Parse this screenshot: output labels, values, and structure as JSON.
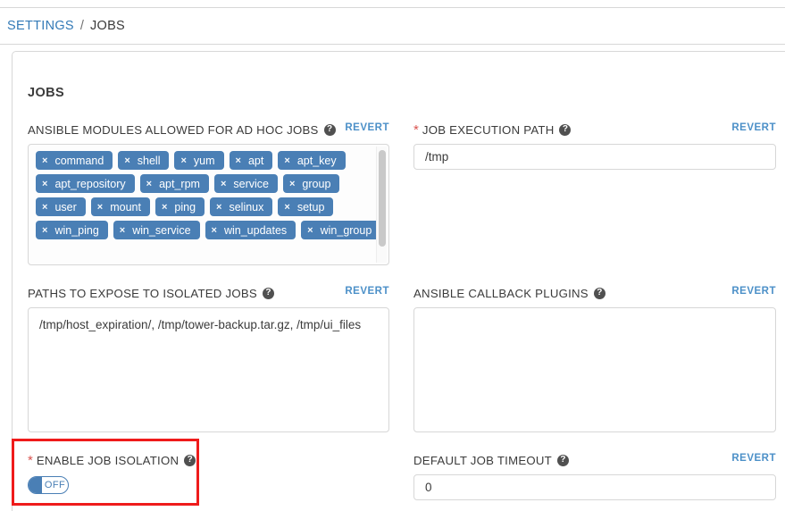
{
  "breadcrumb": {
    "parent": "SETTINGS",
    "separator": "/",
    "current": "JOBS"
  },
  "card": {
    "title": "JOBS"
  },
  "icons": {
    "help": "?",
    "tag_remove": "×"
  },
  "revert_label": "REVERT",
  "fields": {
    "ansible_modules": {
      "label": "ANSIBLE MODULES ALLOWED FOR AD HOC JOBS",
      "required": false,
      "revert": "REVERT",
      "tags": [
        "command",
        "shell",
        "yum",
        "apt",
        "apt_key",
        "apt_repository",
        "apt_rpm",
        "service",
        "group",
        "user",
        "mount",
        "ping",
        "selinux",
        "setup",
        "win_ping",
        "win_service",
        "win_updates",
        "win_group"
      ]
    },
    "job_execution_path": {
      "label": "JOB EXECUTION PATH",
      "required": true,
      "revert": "REVERT",
      "value": "/tmp",
      "placeholder": ""
    },
    "paths_to_expose": {
      "label": "PATHS TO EXPOSE TO ISOLATED JOBS",
      "required": false,
      "revert": "REVERT",
      "value": "/tmp/host_expiration/, /tmp/tower-backup.tar.gz, /tmp/ui_files",
      "placeholder": ""
    },
    "ansible_callback_plugins": {
      "label": "ANSIBLE CALLBACK PLUGINS",
      "required": false,
      "revert": "REVERT",
      "value": "",
      "placeholder": ""
    },
    "enable_job_isolation": {
      "label": "ENABLE JOB ISOLATION",
      "required": true,
      "toggle_state": "OFF"
    },
    "default_job_timeout": {
      "label": "DEFAULT JOB TIMEOUT",
      "required": false,
      "revert": "REVERT",
      "value": "0",
      "placeholder": ""
    }
  },
  "colors": {
    "link": "#337ab7",
    "revert": "#4c90c8",
    "tag": "#4a7fb5",
    "required": "#d9534f",
    "highlight": "#ef1b1b",
    "border": "#d7d7d7",
    "text": "#3b3b3b"
  }
}
